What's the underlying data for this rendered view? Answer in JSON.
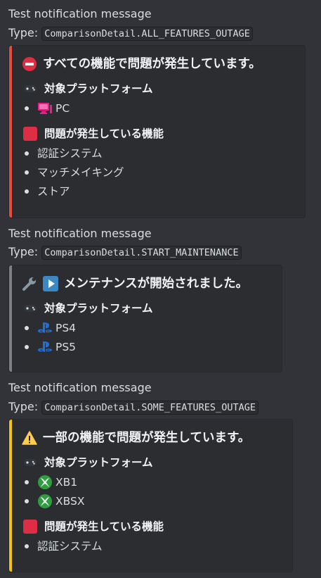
{
  "messages": [
    {
      "text": "Test notification message",
      "type_label": "Type:",
      "type_code": "ComparisonDetail.ALL_FEATURES_OUTAGE",
      "embed": {
        "accent_color": "#e74c3c",
        "title_icon": "no-entry-icon",
        "title": "すべての機能で問題が発生しています。",
        "platforms_label": "対象プラットフォーム",
        "platforms_icon": "game-controller-icon",
        "platforms": [
          {
            "icon": "computer-icon",
            "label": "PC"
          }
        ],
        "features_label": "問題が発生している機能",
        "features_icon": "red-square-icon",
        "features": [
          "認証システム",
          "マッチメイキング",
          "ストア"
        ]
      }
    },
    {
      "text": "Test notification message",
      "type_label": "Type:",
      "type_code": "ComparisonDetail.START_MAINTENANCE",
      "embed": {
        "accent_color": "#7d8087",
        "title_icons": [
          "wrench-icon",
          "play-button-icon"
        ],
        "title": "メンテナンスが開始されました。",
        "platforms_label": "対象プラットフォーム",
        "platforms_icon": "game-controller-icon",
        "platforms": [
          {
            "icon": "playstation-icon",
            "label": "PS4"
          },
          {
            "icon": "playstation-icon",
            "label": "PS5"
          }
        ]
      }
    },
    {
      "text": "Test notification message",
      "type_label": "Type:",
      "type_code": "ComparisonDetail.SOME_FEATURES_OUTAGE",
      "embed": {
        "accent_color": "#f1c40f",
        "title_icon": "warning-icon",
        "title": "一部の機能で問題が発生しています。",
        "platforms_label": "対象プラットフォーム",
        "platforms_icon": "game-controller-icon",
        "platforms": [
          {
            "icon": "xbox-icon",
            "label": "XB1"
          },
          {
            "icon": "xbox-icon",
            "label": "XBSX"
          }
        ],
        "features_label": "問題が発生している機能",
        "features_icon": "red-square-icon",
        "features": [
          "認証システム"
        ]
      }
    }
  ]
}
